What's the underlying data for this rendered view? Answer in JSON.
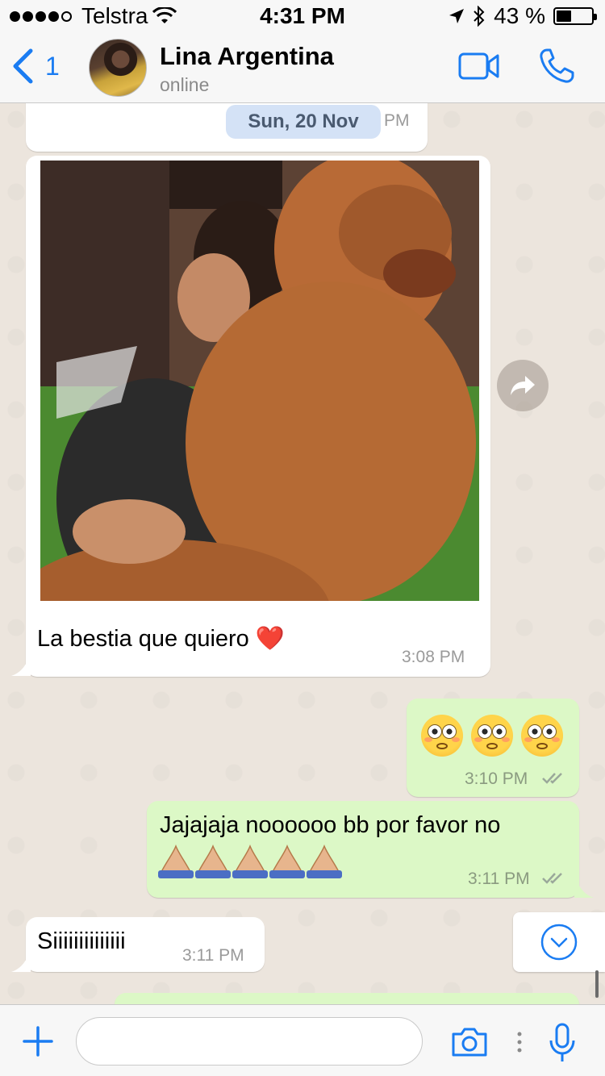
{
  "status_bar": {
    "carrier": "Telstra",
    "time": "4:31 PM",
    "battery_percent": "43 %",
    "battery_level": 0.43
  },
  "header": {
    "back_count": "1",
    "contact_name": "Lina Argentina",
    "contact_status": "online"
  },
  "chat": {
    "date_divider": "Sun, 20 Nov",
    "partial_time": "PM",
    "messages": [
      {
        "direction": "in",
        "type": "image",
        "caption": "La bestia que quiero ❤️",
        "time": "3:08 PM"
      },
      {
        "direction": "out",
        "text": "😳 😳 😳",
        "time": "3:10 PM",
        "status": "read"
      },
      {
        "direction": "out",
        "text": "Jajajaja noooooo bb por favor no",
        "emoji_line": "🙏🏼🙏🏼🙏🏼🙏🏼🙏🏼",
        "time": "3:11 PM",
        "status": "read"
      },
      {
        "direction": "in",
        "text": "Siiiiiiiiiiiiii",
        "time": "3:11 PM"
      }
    ]
  },
  "input": {
    "placeholder": ""
  },
  "colors": {
    "accent": "#1a7cf2",
    "outgoing_bubble": "#dcf8c6",
    "chat_background": "#ece5dd",
    "read_ticks": "#9aa89a"
  }
}
